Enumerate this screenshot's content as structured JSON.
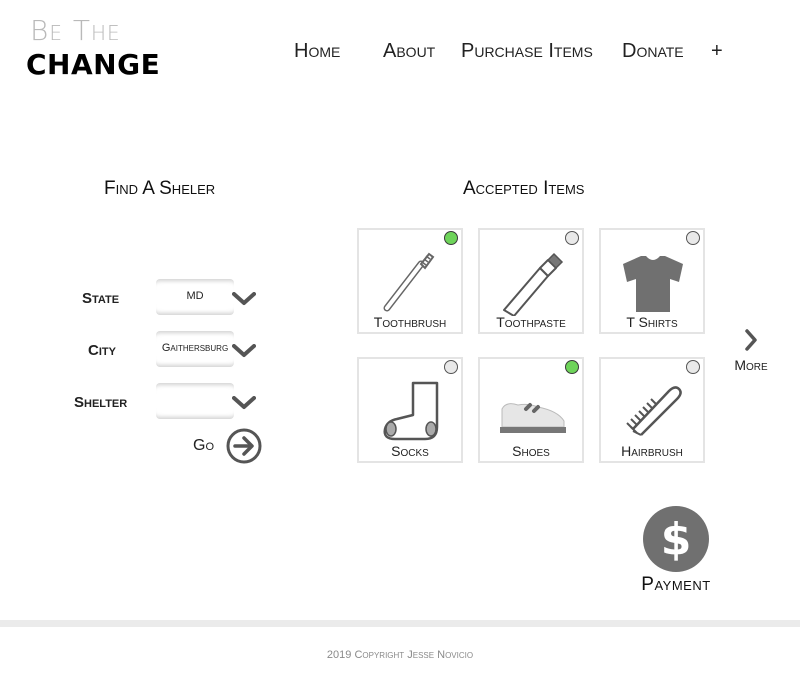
{
  "logo": {
    "line1": "Be The",
    "line2": "CHANGE"
  },
  "nav": {
    "home": "Home",
    "about": "About",
    "purchase": "Purchase Items",
    "donate": "Donate",
    "plus": "+"
  },
  "find_shelter": {
    "title": "Find A Sheler",
    "state_label": "State",
    "state_value": "MD",
    "city_label": "City",
    "city_value": "Gaithersburg",
    "shelter_label": "Shelter",
    "shelter_value": "",
    "go_label": "Go"
  },
  "accepted_items": {
    "title": "Accepted Items",
    "items": [
      {
        "label": "Toothbrush",
        "icon": "toothbrush-icon",
        "selected": true
      },
      {
        "label": "Toothpaste",
        "icon": "toothpaste-icon",
        "selected": false
      },
      {
        "label": "T Shirts",
        "icon": "tshirt-icon",
        "selected": false
      },
      {
        "label": "Socks",
        "icon": "sock-icon",
        "selected": false
      },
      {
        "label": "Shoes",
        "icon": "shoe-icon",
        "selected": true
      },
      {
        "label": "Hairbrush",
        "icon": "hairbrush-icon",
        "selected": false
      }
    ],
    "more_label": "More"
  },
  "payment": {
    "symbol": "$",
    "label": "Payment"
  },
  "footer": {
    "copyright": "2019 Copyright Jesse Novicio"
  },
  "colors": {
    "selected": "#6ed45a",
    "icon_gray": "#707070"
  }
}
